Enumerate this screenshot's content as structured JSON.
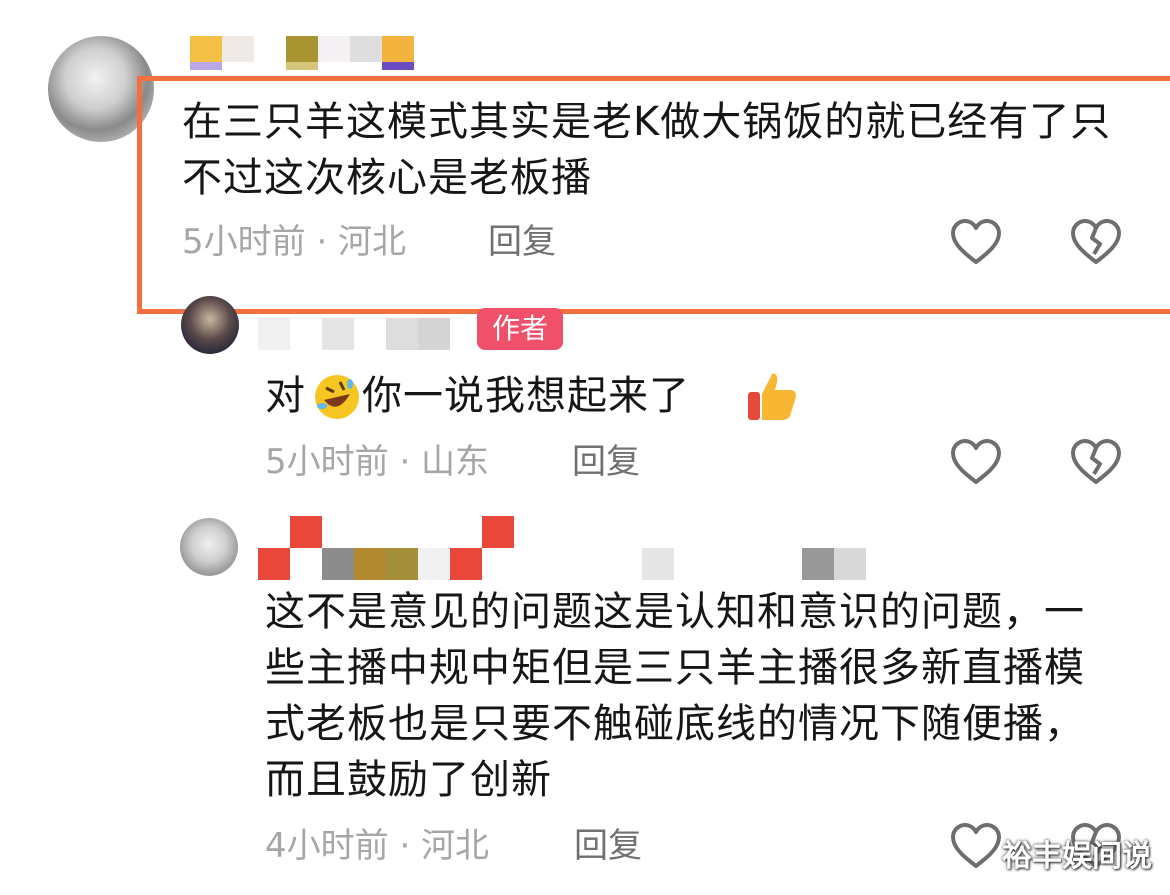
{
  "comments": [
    {
      "text": "在三只羊这模式其实是老K做大锅饭的就已经有了只不过这次核心是老板播",
      "meta": "5小时前 · 河北",
      "reply": "回复"
    },
    {
      "author_badge": "作者",
      "text_before": "对",
      "text_middle": "你一说我想起来了",
      "meta": "5小时前 · 山东",
      "reply": "回复"
    },
    {
      "text": "这不是意见的问题这是认知和意识的问题，一些主播中规中矩但是三只羊主播很多新直播模式老板也是只要不触碰底线的情况下随便播，而且鼓励了创新",
      "meta": "4小时前 · 河北",
      "reply": "回复"
    }
  ],
  "icons": {
    "like": "heart-outline-icon",
    "dislike": "broken-heart-icon",
    "emoji_laugh": "rofl-emoji-icon",
    "emoji_thumbs": "thumbs-up-emoji-icon"
  },
  "colors": {
    "highlight": "#f27040",
    "badge": "#f0506a",
    "meta": "#a6a6a6",
    "text": "#161616"
  },
  "watermark": "裕丰娱间说"
}
